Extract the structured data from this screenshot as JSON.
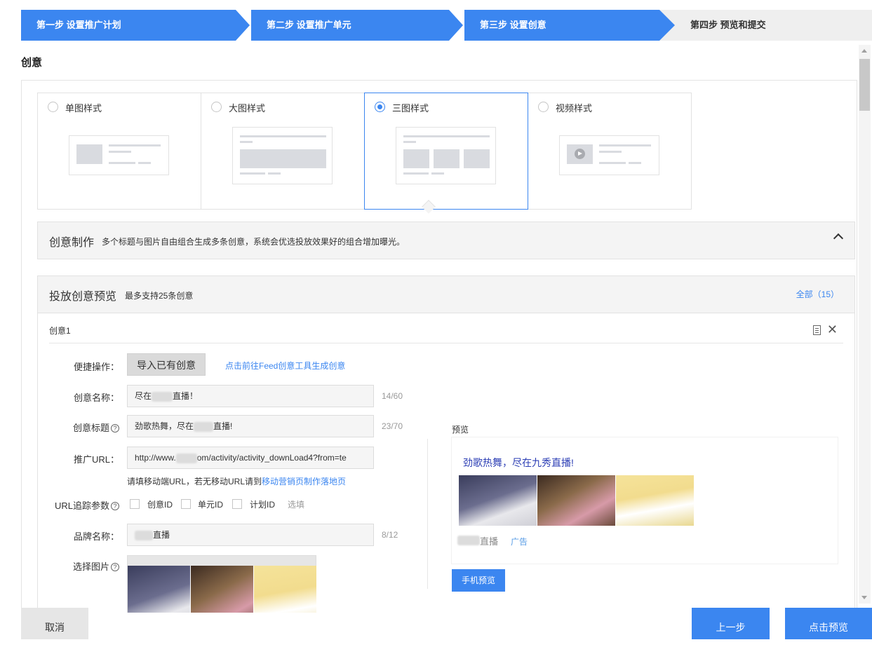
{
  "steps": [
    {
      "label": "第一步 设置推广计划"
    },
    {
      "label": "第二步 设置推广单元"
    },
    {
      "label": "第三步 设置创意"
    },
    {
      "label": "第四步 预览和提交"
    }
  ],
  "section_title": "创意",
  "style_options": [
    {
      "label": "单图样式",
      "selected": false
    },
    {
      "label": "大图样式",
      "selected": false
    },
    {
      "label": "三图样式",
      "selected": true
    },
    {
      "label": "视频样式",
      "selected": false
    }
  ],
  "production": {
    "title": "创意制作",
    "desc": "多个标题与图片自由组合生成多条创意，系统会优选投放效果好的组合增加曝光。"
  },
  "preview_section": {
    "title": "投放创意预览",
    "desc": "最多支持25条创意",
    "all_link": "全部（15）"
  },
  "creative": {
    "name": "创意1",
    "quick_label": "便捷操作：",
    "import_button": "导入已有创意",
    "feed_link": "点击前往Feed创意工具生成创意",
    "name_label": "创意名称：",
    "name_value_prefix": "尽在",
    "name_value_suffix": "直播！",
    "name_count": "14/60",
    "title_label": "创意标题",
    "title_value_prefix": "劲歌热舞，尽在",
    "title_value_suffix": "直播!",
    "title_count": "23/70",
    "url_label": "推广URL：",
    "url_value_prefix": "http://www.",
    "url_value_suffix": "om/activity/activity_downLoad4?from=te",
    "url_hint": "请填移动端URL，若无移动URL请到",
    "url_hint_link": "移动营销页制作落地页",
    "tracking_label": "URL追踪参数",
    "tracking_options": [
      "创意ID",
      "单元ID",
      "计划ID"
    ],
    "tracking_extra": "选填",
    "brand_label": "品牌名称：",
    "brand_value": "直播",
    "brand_count": "8/12",
    "image_label": "选择图片"
  },
  "preview": {
    "label": "预览",
    "title": "劲歌热舞，尽在九秀直播!",
    "brand": "直播",
    "ad_tag": "广告",
    "mobile_button": "手机预览"
  },
  "footer": {
    "cancel": "取消",
    "prev": "上一步",
    "preview": "点击预览"
  },
  "colors": {
    "accent": "#3b86f0",
    "preview_title": "#2d3fb5"
  }
}
